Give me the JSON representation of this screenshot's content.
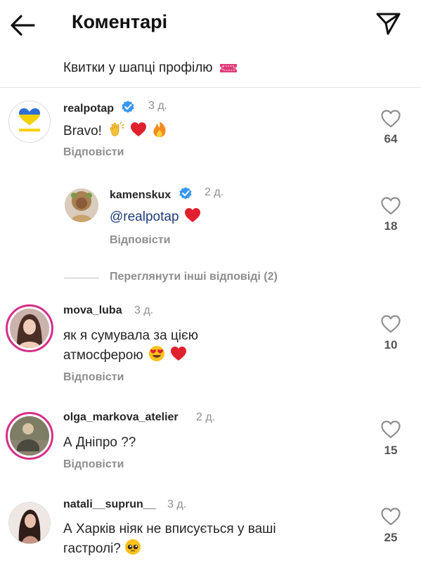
{
  "header": {
    "title": "Коментарі",
    "back_icon": "back-arrow-icon",
    "send_icon": "paper-plane-icon"
  },
  "caption": {
    "text": "Квитки у шапці профілю",
    "emoji_icon": "ticket-icon"
  },
  "comments": [
    {
      "username": "realpotap",
      "verified": true,
      "time": "3 д.",
      "text": "Bravo!",
      "emojis": [
        "clapping-hands-icon",
        "red-heart-icon",
        "fire-icon"
      ],
      "reply_label": "Відповісти",
      "likes": "64"
    },
    {
      "username": "kamenskux",
      "verified": true,
      "time": "2 д.",
      "mention": "@realpotap",
      "emojis": [
        "red-heart-icon"
      ],
      "reply_label": "Відповісти",
      "likes": "18"
    },
    {
      "username": "mova_luba",
      "verified": false,
      "time": "3 д.",
      "text_line1": "як я сумувала за цією",
      "text_line2": "атмосферою",
      "emojis": [
        "heart-eyes-face-icon",
        "red-heart-icon"
      ],
      "reply_label": "Відповісти",
      "likes": "10"
    },
    {
      "username": "olga_markova_atelier",
      "verified": false,
      "time": "2 д.",
      "text": "А Дніпро ??",
      "reply_label": "Відповісти",
      "likes": "15"
    },
    {
      "username": "natali__suprun__",
      "verified": false,
      "time": "3 д.",
      "text_line1": "А Харків ніяк не вписується у ваші",
      "text_line2": "гастролі?",
      "emojis": [
        "pleading-face-icon"
      ],
      "likes": "25"
    }
  ],
  "view_more_replies": "Переглянути інші відповіді (2)",
  "colors": {
    "story_ring": "#d52f88",
    "verified_blue": "#3897f0",
    "heart_red": "#e0202e",
    "mention": "#1f3c78",
    "secondary_text": "#8e8e8e"
  }
}
